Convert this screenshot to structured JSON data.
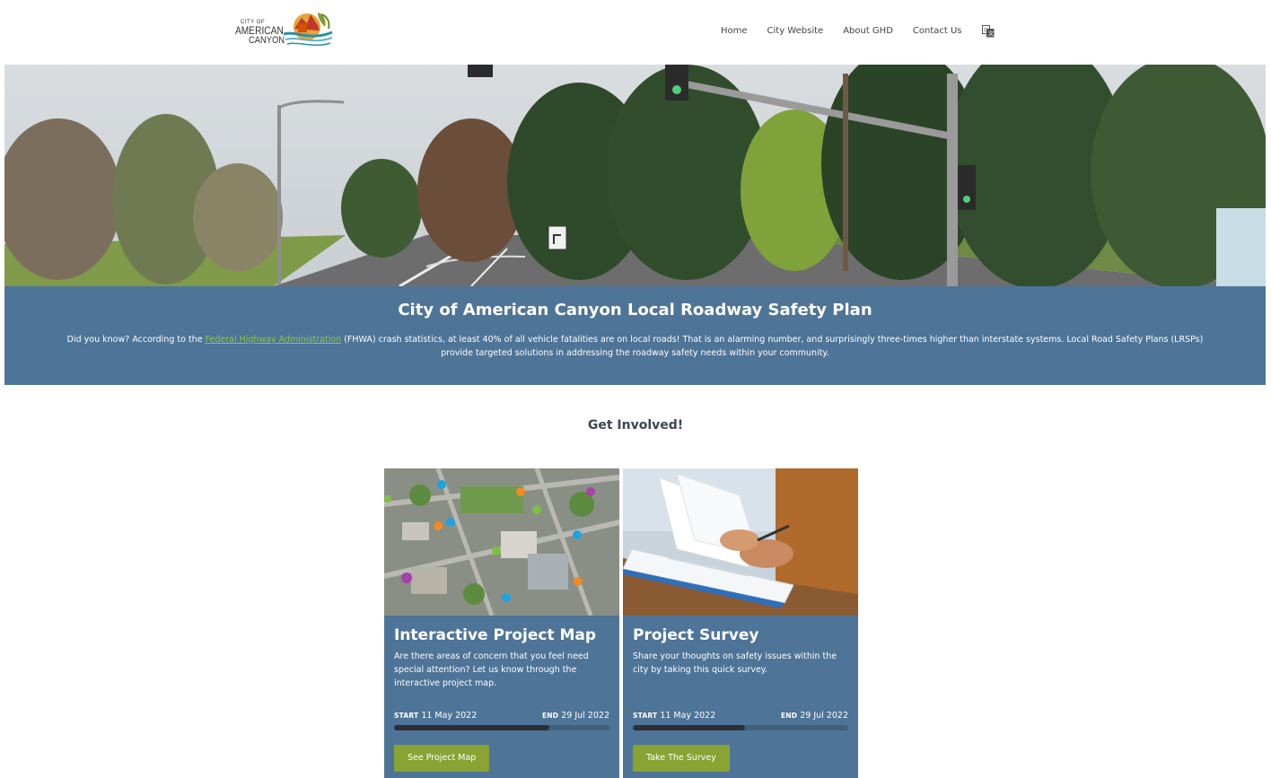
{
  "header": {
    "logo": {
      "line1": "CITY OF",
      "line2": "AMERICAN",
      "line3": "CANYON"
    },
    "nav": [
      {
        "label": "Home"
      },
      {
        "label": "City Website"
      },
      {
        "label": "About GHD"
      },
      {
        "label": "Contact Us"
      }
    ],
    "translate_icon": "translate-icon"
  },
  "banner": {
    "title": "City of American Canyon Local Roadway Safety Plan",
    "text_before_link": "Did you know? According to the ",
    "link_text": "Federal Highway Administration",
    "text_after_link": " (FHWA) crash statistics, at least 40% of all vehicle fatalities are on local roads! That is an alarming number, and surprisingly three-times higher than interstate systems. Local Road Safety Plans (LRSPs) provide targeted solutions in addressing the roadway safety needs within your community.",
    "link_color": "#8fc641"
  },
  "section": {
    "title": "Get Involved!"
  },
  "cards": [
    {
      "title": "Interactive Project Map",
      "description": "Are there areas of concern that you feel need special attention? Let us know through the interactive project map.",
      "start_label": "START",
      "start_date": "11 May 2022",
      "end_label": "END",
      "end_date": "29 Jul 2022",
      "progress": 0.72,
      "button": "See Project Map"
    },
    {
      "title": "Project Survey",
      "description": "Share your thoughts on safety issues within the city by taking this quick survey.",
      "start_label": "START",
      "start_date": "11 May 2022",
      "end_label": "END",
      "end_date": "29 Jul 2022",
      "progress": 0.52,
      "button": "Take The Survey"
    }
  ],
  "colors": {
    "banner_bg": "#4e7497",
    "button_bg": "#8aa332",
    "progress_fill": "#2c2f33"
  }
}
